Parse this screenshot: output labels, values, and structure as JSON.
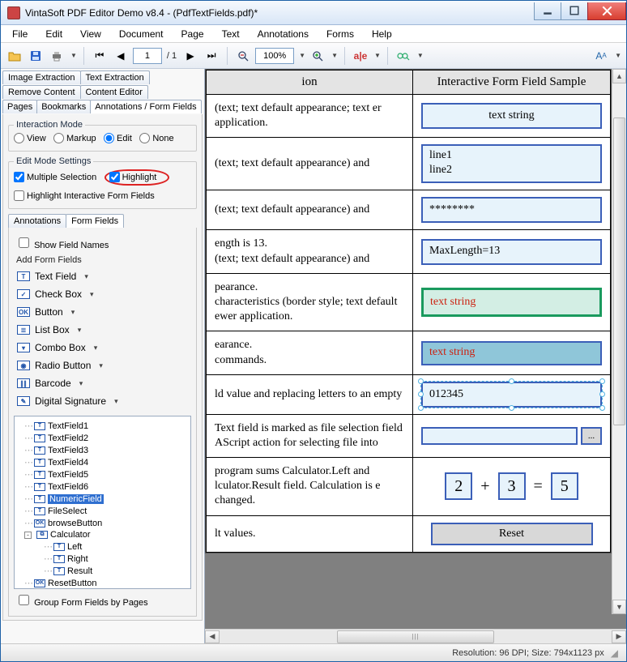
{
  "window": {
    "title": "VintaSoft PDF Editor Demo v8.4 -  (PdfTextFields.pdf)*"
  },
  "menu": {
    "items": [
      "File",
      "Edit",
      "View",
      "Document",
      "Page",
      "Text",
      "Annotations",
      "Forms",
      "Help"
    ]
  },
  "toolbar": {
    "page_current": "1",
    "page_total": "/ 1",
    "zoom": "100%"
  },
  "tabs_top_row1": [
    "Image Extraction",
    "Text Extraction"
  ],
  "tabs_top_row2": [
    "Remove Content",
    "Content Editor"
  ],
  "tabs_top_row3": [
    "Pages",
    "Bookmarks",
    "Annotations / Form Fields"
  ],
  "interaction_mode": {
    "legend": "Interaction Mode",
    "options": [
      "View",
      "Markup",
      "Edit",
      "None"
    ],
    "selected": "Edit"
  },
  "edit_mode": {
    "legend": "Edit Mode Settings",
    "multiple_selection_label": "Multiple Selection",
    "highlight_label": "Highlight",
    "highlight_fields_label": "Highlight Interactive Form  Fields"
  },
  "subtabs": [
    "Annotations",
    "Form Fields"
  ],
  "show_field_names": "Show Field Names",
  "add_form_fields_header": "Add Form Fields",
  "add_items": [
    {
      "label": "Text Field",
      "glyph": "T"
    },
    {
      "label": "Check Box",
      "glyph": "✓"
    },
    {
      "label": "Button",
      "glyph": "OK"
    },
    {
      "label": "List Box",
      "glyph": "≣"
    },
    {
      "label": "Combo Box",
      "glyph": "▾"
    },
    {
      "label": "Radio Button",
      "glyph": "◉"
    },
    {
      "label": "Barcode",
      "glyph": "∥∥"
    },
    {
      "label": "Digital Signature",
      "glyph": "✎"
    }
  ],
  "tree": [
    {
      "label": "TextField1",
      "level": 1,
      "icon": "T"
    },
    {
      "label": "TextField2",
      "level": 1,
      "icon": "T"
    },
    {
      "label": "TextField3",
      "level": 1,
      "icon": "T"
    },
    {
      "label": "TextField4",
      "level": 1,
      "icon": "T"
    },
    {
      "label": "TextField5",
      "level": 1,
      "icon": "T"
    },
    {
      "label": "TextField6",
      "level": 1,
      "icon": "T"
    },
    {
      "label": "NumericField",
      "level": 1,
      "icon": "T",
      "selected": true
    },
    {
      "label": "FileSelect",
      "level": 1,
      "icon": "T"
    },
    {
      "label": "browseButton",
      "level": 1,
      "icon": "OK"
    },
    {
      "label": "Calculator",
      "level": 1,
      "icon": "⧉",
      "expander": "-",
      "children": true
    },
    {
      "label": "Left",
      "level": 2,
      "icon": "T"
    },
    {
      "label": "Right",
      "level": 2,
      "icon": "T"
    },
    {
      "label": "Result",
      "level": 2,
      "icon": "T"
    },
    {
      "label": "ResetButton",
      "level": 1,
      "icon": "OK"
    }
  ],
  "group_by_pages": "Group Form Fields by Pages",
  "doc": {
    "headers": {
      "desc": "ion",
      "sample": "Interactive Form Field Sample"
    },
    "rows": [
      {
        "desc": "(text; text default appearance; text er application.",
        "sample_text": "text string",
        "style": "center"
      },
      {
        "desc": "(text; text default appearance) and",
        "multiline": [
          "line1",
          "line2"
        ],
        "style": "multi"
      },
      {
        "desc": "(text; text default appearance) and",
        "sample_text": "********",
        "style": "left"
      },
      {
        "desc": "ength is 13.\n(text; text default appearance) and",
        "sample_text": "MaxLength=13",
        "style": "left"
      },
      {
        "desc": "pearance.\ncharacteristics (border style; text default ewer application.",
        "sample_text": "text string",
        "style": "green"
      },
      {
        "desc": "earance.\ncommands.",
        "sample_text": "text string",
        "style": "dark"
      },
      {
        "desc": "ld value and replacing letters to an empty",
        "sample_text": "012345",
        "style": "selected"
      },
      {
        "desc": " Text field is marked as file selection field AScript action for selecting file into",
        "style": "filesel",
        "browse": "..."
      },
      {
        "desc": "program sums Calculator.Left and lculator.Result field. Calculation is e changed.",
        "style": "calc",
        "calc": {
          "a": "2",
          "op1": "+",
          "b": "3",
          "op2": "=",
          "c": "5"
        }
      },
      {
        "desc": "lt values.",
        "style": "reset",
        "button": "Reset"
      }
    ]
  },
  "status": {
    "text": "Resolution: 96 DPI; Size: 794x1123 px"
  }
}
